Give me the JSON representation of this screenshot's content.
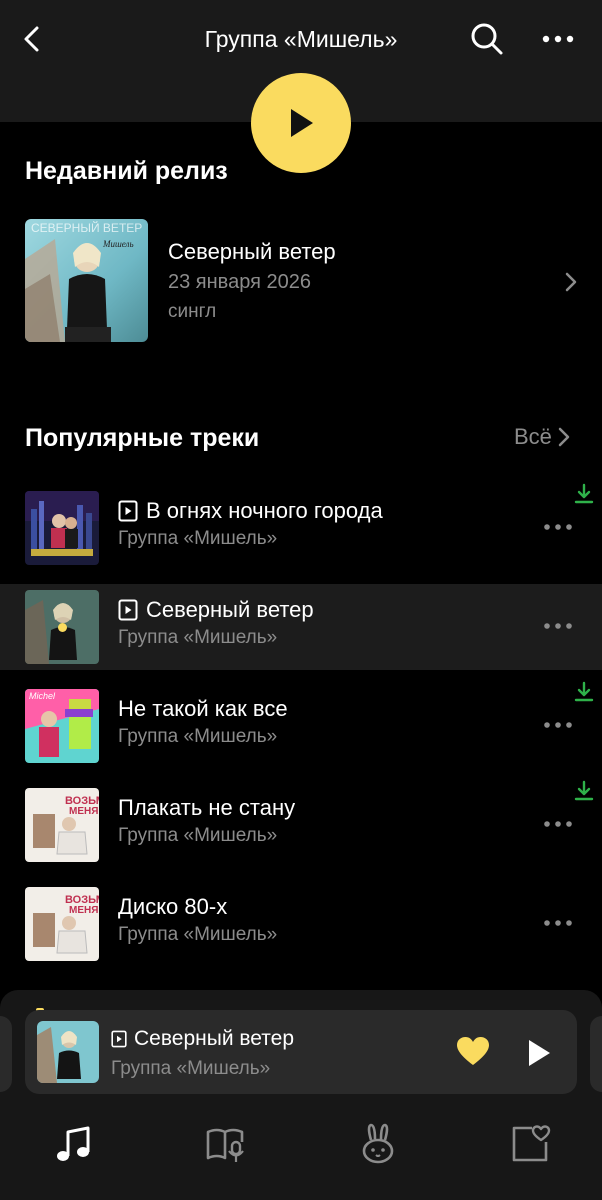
{
  "header": {
    "title": "Группа «Мишель»",
    "back_icon": "chevron-left-icon",
    "search_icon": "search-icon",
    "more_icon": "more-icon"
  },
  "play_button": {
    "icon": "play-icon",
    "color": "#fadb5f"
  },
  "recent_release": {
    "heading": "Недавний релиз",
    "name": "Северный ветер",
    "date": "23 января 2026",
    "type": "сингл"
  },
  "popular": {
    "heading": "Популярные треки",
    "all_label": "Всё",
    "tracks": [
      {
        "name": "В огнях ночного города",
        "artist": "Группа «Мишель»",
        "has_video": true,
        "downloaded": true,
        "playing": false
      },
      {
        "name": "Северный ветер",
        "artist": "Группа «Мишель»",
        "has_video": true,
        "downloaded": false,
        "playing": true
      },
      {
        "name": "Не такой как все",
        "artist": "Группа «Мишель»",
        "has_video": false,
        "downloaded": true,
        "playing": false
      },
      {
        "name": "Плакать не стану",
        "artist": "Группа «Мишель»",
        "has_video": false,
        "downloaded": true,
        "playing": false
      },
      {
        "name": "Диско 80-х",
        "artist": "Группа «Мишель»",
        "has_video": false,
        "downloaded": false,
        "playing": false
      }
    ]
  },
  "mini_player": {
    "name": "Северный ветер",
    "artist": "Группа «Мишель»",
    "liked": true
  },
  "tabs": [
    {
      "name": "music-note-icon",
      "active": true
    },
    {
      "name": "book-mic-icon",
      "active": false
    },
    {
      "name": "rabbit-icon",
      "active": false
    },
    {
      "name": "collection-heart-icon",
      "active": false
    }
  ],
  "colors": {
    "accent": "#fadb5f",
    "download": "#2fb14a",
    "secondary_text": "#8c8c8c"
  }
}
